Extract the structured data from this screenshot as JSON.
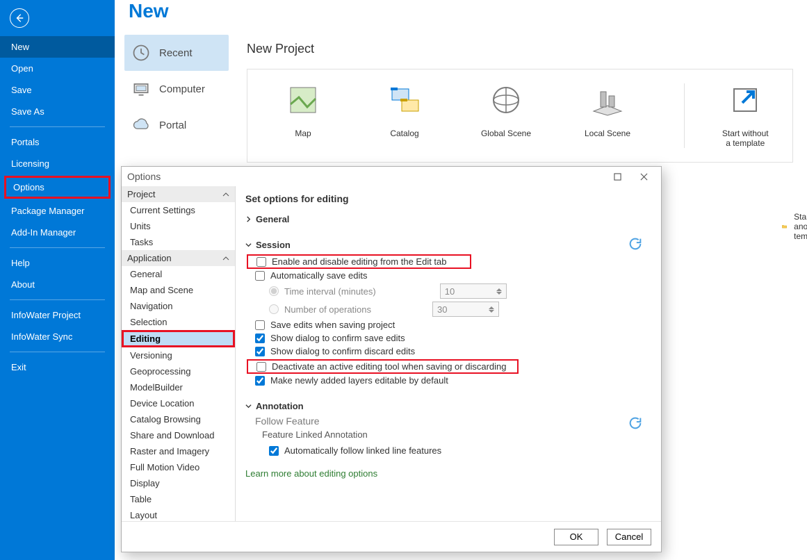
{
  "sideMenu": {
    "items": [
      "New",
      "Open",
      "Save",
      "Save As"
    ],
    "group2": [
      "Portals",
      "Licensing",
      "Options",
      "Package Manager",
      "Add-In Manager"
    ],
    "group3": [
      "Help",
      "About"
    ],
    "group4": [
      "InfoWater Project",
      "InfoWater Sync"
    ],
    "group5": [
      "Exit"
    ],
    "selected": "New",
    "highlighted": "Options"
  },
  "start": {
    "heading": "New",
    "tabs": [
      "Recent",
      "Computer",
      "Portal"
    ],
    "selectedTab": "Recent",
    "newProject": "New Project",
    "templates": [
      "Map",
      "Catalog",
      "Global Scene",
      "Local Scene"
    ],
    "withoutTemplate": "Start without a template",
    "anotherTemplate": "Start with another template"
  },
  "dialog": {
    "title": "Options",
    "heading": "Set options for editing",
    "sections": {
      "general": "General",
      "session": "Session",
      "annotation": "Annotation"
    },
    "session": {
      "enableDisable": "Enable and disable editing from the Edit tab",
      "autoSave": "Automatically save edits",
      "timeInterval": "Time interval (minutes)",
      "timeVal": "10",
      "numOps": "Number of operations",
      "numVal": "30",
      "saveOnProject": "Save edits when saving project",
      "confirmSave": "Show dialog to confirm save edits",
      "confirmDiscard": "Show dialog to confirm discard edits",
      "deactivate": "Deactivate an active editing tool when saving or discarding",
      "makeEditable": "Make newly added layers editable by default"
    },
    "annotation": {
      "followFeature": "Follow Feature",
      "featureLinked": "Feature Linked Annotation",
      "autoFollow": "Automatically follow linked line features"
    },
    "learnMore": "Learn more about editing options",
    "categories": {
      "project": {
        "label": "Project",
        "items": [
          "Current Settings",
          "Units",
          "Tasks"
        ]
      },
      "application": {
        "label": "Application",
        "items": [
          "General",
          "Map and Scene",
          "Navigation",
          "Selection",
          "Editing",
          "Versioning",
          "Geoprocessing",
          "ModelBuilder",
          "Device Location",
          "Catalog Browsing",
          "Share and Download",
          "Raster and Imagery",
          "Full Motion Video",
          "Display",
          "Table",
          "Layout"
        ]
      }
    },
    "selectedCategory": "Editing",
    "buttons": {
      "ok": "OK",
      "cancel": "Cancel"
    }
  }
}
